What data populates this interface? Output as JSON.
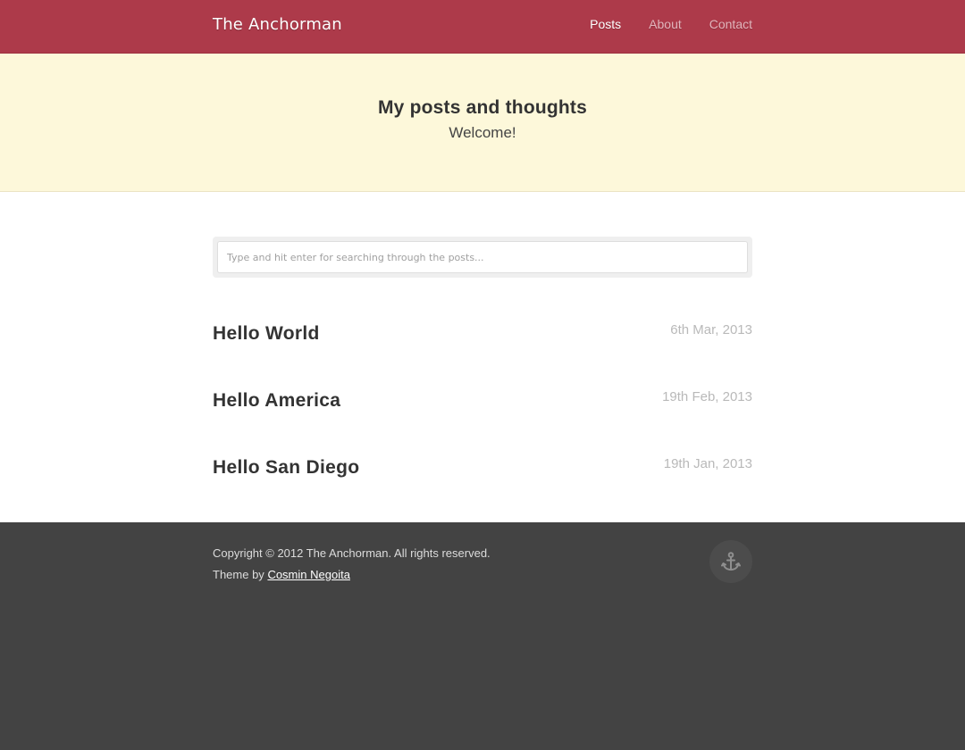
{
  "header": {
    "brand": "The Anchorman",
    "nav": [
      {
        "label": "Posts",
        "active": true
      },
      {
        "label": "About",
        "active": false
      },
      {
        "label": "Contact",
        "active": false
      }
    ]
  },
  "hero": {
    "title": "My posts and thoughts",
    "subtitle": "Welcome!"
  },
  "search": {
    "placeholder": "Type and hit enter for searching through the posts..."
  },
  "posts": [
    {
      "title": "Hello World",
      "date": "6th Mar, 2013"
    },
    {
      "title": "Hello America",
      "date": "19th Feb, 2013"
    },
    {
      "title": "Hello San Diego",
      "date": "19th Jan, 2013"
    }
  ],
  "footer": {
    "copyright": "Copyright © 2012 The Anchorman. All rights reserved.",
    "theme_prefix": "Theme by",
    "theme_author": "Cosmin Negoita",
    "icon": "anchor-icon"
  },
  "colors": {
    "header_bg": "#ad3a4a",
    "hero_bg": "#fdf8da",
    "footer_bg": "#434343"
  }
}
